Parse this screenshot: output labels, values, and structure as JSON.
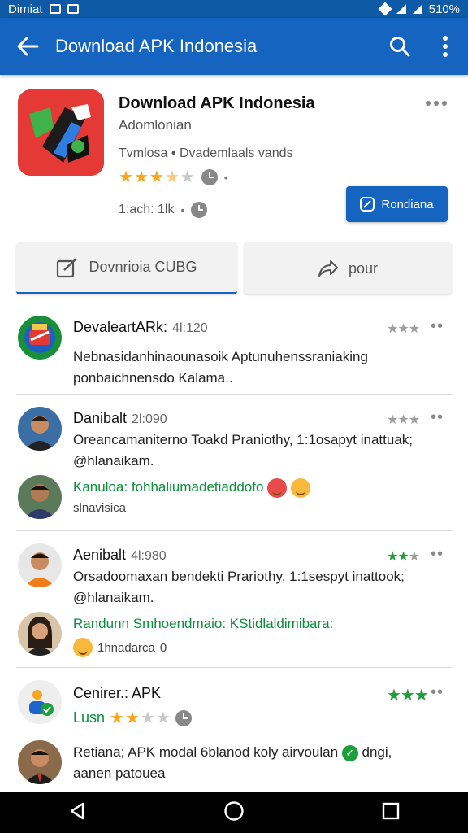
{
  "status_bar": {
    "carrier": "Dimiat",
    "battery": "510%"
  },
  "appbar": {
    "title": "Download APK Indonesia"
  },
  "app": {
    "name": "Download APK Indonesia",
    "developer": "Adomlonian",
    "meta": "Tvmlosa • Dvademlaals vands",
    "rating_stars": 3.5,
    "downloads": "1:ach: 1lk",
    "primary_button": "Rondiana"
  },
  "tabs": [
    {
      "label": "Dovnrioia CUBG"
    },
    {
      "label": "pour"
    }
  ],
  "reviews": [
    {
      "title": "DevaleartARk:",
      "time": "4l:120",
      "text": "Nebnasidanhinaounasoik Aptunuhenssraniaking ponbaichnensdo Kalama..",
      "stars": 3
    },
    {
      "title": "Danibalt",
      "time": "2l:090",
      "text": "Oreancamaniterno Toakd Praniothy, 1:1osapyt inattuak; @hlanaikam.",
      "stars": 3,
      "reply": {
        "text": "Kanuloa: fohhaliumadetiaddofo",
        "sub": "slnavisica"
      }
    },
    {
      "title": "Aenibalt",
      "time": "4l:980",
      "text": "Orsadoomaxan bendekti Prariothy, 1:1sespyt inattook; @hlanaikam.",
      "stars": 3,
      "reply": {
        "text": "Randunn Smhoendmaio: KStidlaldimibara:",
        "sub": "1hnadarca",
        "sub_num": "0"
      }
    },
    {
      "title": "Cenirer.: APK",
      "label": "Lusn",
      "stars": 3,
      "rating_stars": 2,
      "reply": {
        "text": "Retiana; APK modal 6blanod koly airvoulan",
        "text_end": "dngi, aanen patouea"
      }
    }
  ],
  "colors": {
    "primary": "#1565c0",
    "star": "#f5a623",
    "green": "#0a8f3a"
  }
}
